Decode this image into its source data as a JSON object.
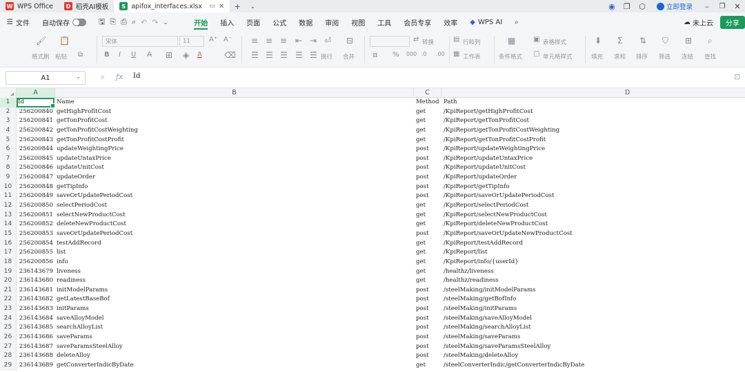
{
  "tabs": [
    {
      "label": "WPS Office",
      "icon": "wps-logo-icon",
      "color": "#e23b2e"
    },
    {
      "label": "稻壳AI模板",
      "icon": "docer-icon",
      "color": "#e23b2e"
    },
    {
      "label": "apifox_interfaces.xlsx",
      "icon": "spreadsheet-icon",
      "color": "#1b9a5a",
      "active": true
    }
  ],
  "window": {
    "login_label": "立即登录"
  },
  "menubar": {
    "file_label": "文件",
    "autosave_label": "自动保存",
    "items": [
      "开始",
      "插入",
      "页面",
      "公式",
      "数据",
      "审阅",
      "视图",
      "工具",
      "会员专享",
      "效率"
    ],
    "active_item": "开始",
    "wps_ai_label": "WPS AI",
    "upload_label": "未上云",
    "share_label": "分享",
    "accent_color": "#1b9a5a"
  },
  "ribbon": {
    "labels": {
      "format_painter": "格式刷",
      "paste": "粘贴",
      "font_name": "宋体",
      "font_size": "11",
      "wrap": "换行",
      "merge": "合并",
      "convert": "转换",
      "rows_cols": "行和列",
      "worksheet": "工作表",
      "cond_format": "条件格式",
      "table_style": "表格样式",
      "cell_style": "单元格样式",
      "fill": "填充",
      "sum": "求和",
      "sort": "排序",
      "filter": "筛选",
      "freeze": "冻结",
      "find": "查找"
    }
  },
  "formula_bar": {
    "cell_ref": "A1",
    "formula": "Id"
  },
  "columns": [
    "A",
    "B",
    "C",
    "D"
  ],
  "selected_column": "A",
  "header_row": {
    "id": "Id",
    "name": "Name",
    "method": "Method",
    "path": "Path"
  },
  "rows": [
    {
      "id": "256200840",
      "name": "getHighProfitCost",
      "method": "get",
      "path": "/KpiReport/getHighProfitCost"
    },
    {
      "id": "256200841",
      "name": "getTonProfitCost",
      "method": "get",
      "path": "/KpiReport/getTonProfitCost"
    },
    {
      "id": "256200842",
      "name": "getTonProfitCostWeighting",
      "method": "get",
      "path": "/KpiReport/getTonProfitCostWeighting"
    },
    {
      "id": "256200843",
      "name": "getTonProfitCostProfit",
      "method": "get",
      "path": "/KpiReport/getTonProfitCostProfit"
    },
    {
      "id": "256200844",
      "name": "updateWeightingPrice",
      "method": "post",
      "path": "/KpiReport/updateWeightingPrice"
    },
    {
      "id": "256200845",
      "name": "updateUntaxPrice",
      "method": "post",
      "path": "/KpiReport/updateUntaxPrice"
    },
    {
      "id": "256200846",
      "name": "updateUnitCost",
      "method": "post",
      "path": "/KpiReport/updateUnitCost"
    },
    {
      "id": "256200847",
      "name": "updateOrder",
      "method": "post",
      "path": "/KpiReport/updateOrder"
    },
    {
      "id": "256200848",
      "name": "getTipInfo",
      "method": "post",
      "path": "/KpiReport/getTipInfo"
    },
    {
      "id": "256200849",
      "name": "saveOrUpdatePeriodCost",
      "method": "post",
      "path": "/KpiReport/saveOrUpdatePeriodCost"
    },
    {
      "id": "256200850",
      "name": "selectPeriodCost",
      "method": "get",
      "path": "/KpiReport/selectPeriodCost"
    },
    {
      "id": "256200851",
      "name": "selectNewProductCost",
      "method": "get",
      "path": "/KpiReport/selectNewProductCost"
    },
    {
      "id": "256200852",
      "name": "deleteNewProductCost",
      "method": "get",
      "path": "/KpiReport/deleteNewProductCost"
    },
    {
      "id": "256200853",
      "name": "saveOrUpdatePeriodCost",
      "method": "post",
      "path": "/KpiReport/saveOrUpdateNewProductCost"
    },
    {
      "id": "256200854",
      "name": "testAddRecord",
      "method": "get",
      "path": "/KpiReport/testAddRecord"
    },
    {
      "id": "256200855",
      "name": "list",
      "method": "get",
      "path": "/KpiReport/list"
    },
    {
      "id": "256200856",
      "name": "info",
      "method": "get",
      "path": "/KpiReport/info/{userId}"
    },
    {
      "id": "236143679",
      "name": "liveness",
      "method": "get",
      "path": "/healthz/liveness"
    },
    {
      "id": "236143680",
      "name": "readiness",
      "method": "get",
      "path": "/healthz/readiness"
    },
    {
      "id": "236143681",
      "name": "initModelParams",
      "method": "post",
      "path": "/steelMaking/initModelParams"
    },
    {
      "id": "236143682",
      "name": "getLatestBaseBof",
      "method": "post",
      "path": "/steelMaking/getBofInfo"
    },
    {
      "id": "236143683",
      "name": "initParams",
      "method": "post",
      "path": "/steelMaking/initParams"
    },
    {
      "id": "236143684",
      "name": "saveAlloyModel",
      "method": "post",
      "path": "/steelMaking/saveAlloyModel"
    },
    {
      "id": "236143685",
      "name": "searchAlloyList",
      "method": "post",
      "path": "/steelMaking/searchAlloyList"
    },
    {
      "id": "236143686",
      "name": "saveParams",
      "method": "post",
      "path": "/steelMaking/saveParams"
    },
    {
      "id": "236143687",
      "name": "saveParamsSteelAlloy",
      "method": "post",
      "path": "/steelMaking/saveParamsSteelAlloy"
    },
    {
      "id": "236143688",
      "name": "deleteAlloy",
      "method": "post",
      "path": "/steelMaking/deleteAlloy"
    },
    {
      "id": "236143689",
      "name": "getConverterIndicByDate",
      "method": "get",
      "path": "/steelConverterIndic/getConverterIndicByDate"
    }
  ]
}
